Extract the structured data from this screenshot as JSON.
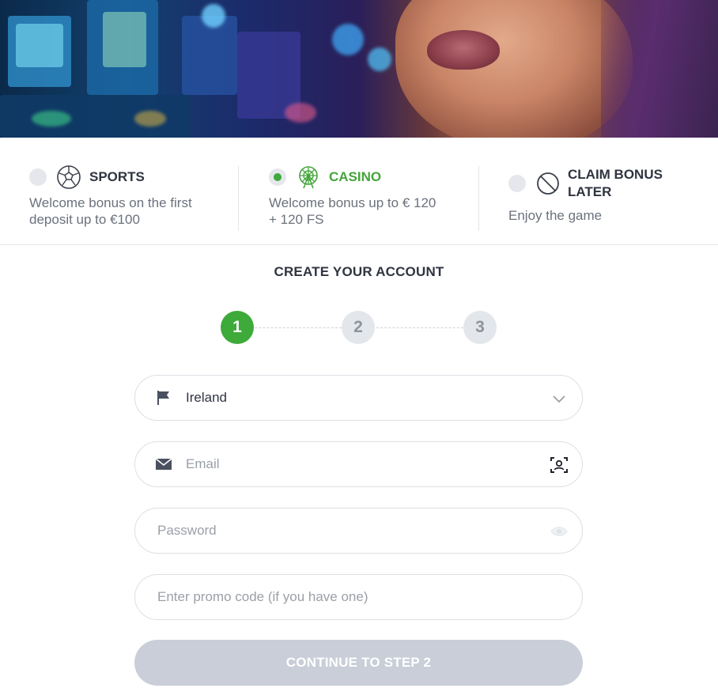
{
  "bonuses": [
    {
      "title": "SPORTS",
      "desc_line1": "Welcome bonus on the first",
      "desc_line2": "deposit up to €100",
      "icon": "soccer-ball-icon",
      "selected": false
    },
    {
      "title": "CASINO",
      "desc_line1": "Welcome bonus up to € 120",
      "desc_line2": "+ 120 FS",
      "icon": "ferris-wheel-icon",
      "selected": true
    },
    {
      "title_line1": "CLAIM BONUS",
      "title_line2": "LATER",
      "desc_line1": "Enjoy the game",
      "icon": "prohibited-icon",
      "selected": false
    }
  ],
  "form": {
    "title": "CREATE YOUR ACCOUNT",
    "steps": [
      "1",
      "2",
      "3"
    ],
    "active_step": 1,
    "country": {
      "value": "Ireland",
      "icon": "flag-icon"
    },
    "email": {
      "placeholder": "Email",
      "icon": "envelope-icon",
      "right_icon": "face-id-icon"
    },
    "password": {
      "placeholder": "Password",
      "right_icon": "eye-icon"
    },
    "promo": {
      "placeholder": "Enter promo code (if you have one)"
    },
    "submit_label": "CONTINUE TO STEP 2"
  },
  "colors": {
    "accent": "#3daa3a",
    "disabled_button": "#c9ced8"
  }
}
